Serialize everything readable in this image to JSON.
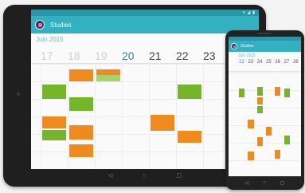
{
  "tablet": {
    "status_icons": [
      "▾",
      "◢",
      "▮"
    ],
    "status_time": "",
    "app_title": "Studies",
    "month": "Juin 2015",
    "days": [
      {
        "dn": "",
        "dd": "17",
        "cls": ""
      },
      {
        "dn": "",
        "dd": "18",
        "cls": ""
      },
      {
        "dn": "",
        "dd": "19",
        "cls": ""
      },
      {
        "dn": "",
        "dd": "20",
        "cls": "today"
      },
      {
        "dn": "",
        "dd": "21",
        "cls": "dark"
      },
      {
        "dn": "",
        "dd": "22",
        "cls": "dark"
      },
      {
        "dn": "",
        "dd": "23",
        "cls": "dark"
      }
    ],
    "times": [
      "",
      "",
      "",
      "",
      "",
      "",
      "",
      ""
    ],
    "events": [
      {
        "c": "o",
        "day": 1,
        "row": 0.3,
        "h": 0.7,
        "t": ""
      },
      {
        "c": "o",
        "day": 2,
        "row": 0.3,
        "h": 0.35,
        "t": ""
      },
      {
        "c": "lg",
        "day": 2,
        "row": 0.65,
        "h": 0.35,
        "t": ""
      },
      {
        "c": "g",
        "day": 0,
        "row": 1.2,
        "h": 0.8,
        "t": ""
      },
      {
        "c": "g",
        "day": 1,
        "row": 1.9,
        "h": 0.8,
        "t": ""
      },
      {
        "c": "g",
        "day": 5,
        "row": 1.2,
        "h": 0.8,
        "t": ""
      },
      {
        "c": "o",
        "day": 0,
        "row": 3.0,
        "h": 0.7,
        "t": ""
      },
      {
        "c": "g",
        "day": 0,
        "row": 3.75,
        "h": 0.6,
        "t": ""
      },
      {
        "c": "o",
        "day": 1,
        "row": 3.5,
        "h": 0.8,
        "t": ""
      },
      {
        "c": "o",
        "day": 4,
        "row": 2.9,
        "h": 0.9,
        "t": ""
      },
      {
        "c": "o",
        "day": 5,
        "row": 3.8,
        "h": 0.7,
        "t": ""
      },
      {
        "c": "o",
        "day": 1,
        "row": 4.6,
        "h": 0.7,
        "t": ""
      }
    ],
    "nav_icons": [
      "◁",
      "○",
      "▢"
    ]
  },
  "phone": {
    "app_title": "Studies",
    "month": "Juin 2015",
    "days": [
      {
        "dn": "",
        "dd": "22",
        "cls": "today"
      },
      {
        "dn": "",
        "dd": "23",
        "cls": ""
      },
      {
        "dn": "",
        "dd": "24",
        "cls": ""
      },
      {
        "dn": "",
        "dd": "25",
        "cls": ""
      },
      {
        "dn": "",
        "dd": "26",
        "cls": ""
      },
      {
        "dn": "",
        "dd": "27",
        "cls": ""
      },
      {
        "dn": "",
        "dd": "28",
        "cls": ""
      }
    ],
    "events": [
      {
        "c": "g",
        "day": 0,
        "row": 0.9,
        "h": 0.5
      },
      {
        "c": "g",
        "day": 2,
        "row": 0.8,
        "h": 0.5
      },
      {
        "c": "o",
        "day": 2,
        "row": 1.4,
        "h": 0.4
      },
      {
        "c": "g",
        "day": 2,
        "row": 1.9,
        "h": 0.4
      },
      {
        "c": "o",
        "day": 4,
        "row": 0.8,
        "h": 0.5
      },
      {
        "c": "g",
        "day": 5,
        "row": 0.9,
        "h": 0.5
      },
      {
        "c": "o",
        "day": 1,
        "row": 2.7,
        "h": 0.5
      },
      {
        "c": "o",
        "day": 3,
        "row": 3.1,
        "h": 0.5
      },
      {
        "c": "o",
        "day": 2,
        "row": 3.7,
        "h": 0.5
      },
      {
        "c": "g",
        "day": 5,
        "row": 3.6,
        "h": 0.5
      },
      {
        "c": "o",
        "day": 1,
        "row": 4.5,
        "h": 0.5
      },
      {
        "c": "o",
        "day": 4,
        "row": 4.4,
        "h": 0.5
      }
    ],
    "nav_icons": [
      "◁",
      "○",
      "▢"
    ]
  }
}
